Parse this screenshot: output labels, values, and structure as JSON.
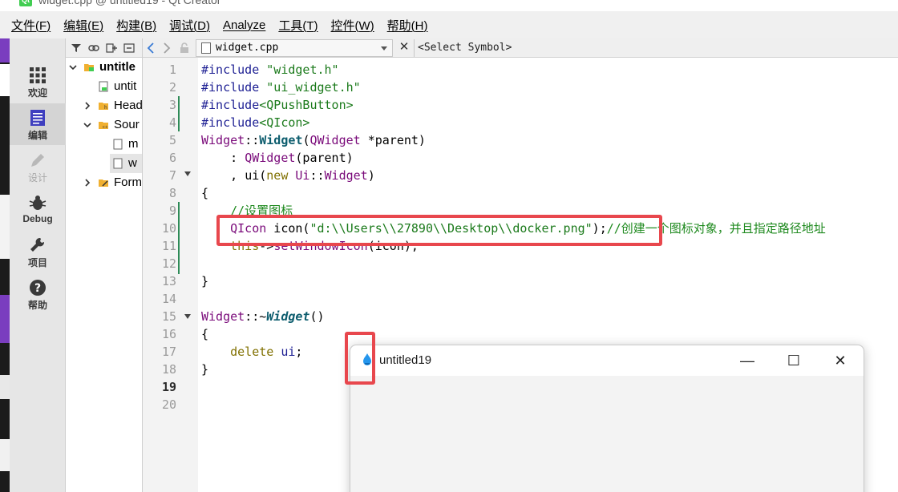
{
  "window": {
    "title": "widget.cpp @ untitled19 - Qt Creator"
  },
  "menu": [
    {
      "label": "文件(F)",
      "underline": true
    },
    {
      "label": "编辑(E)",
      "underline": true
    },
    {
      "label": "构建(B)",
      "underline": true
    },
    {
      "label": "调试(D)",
      "underline": true
    },
    {
      "label": "Analyze",
      "underline": true
    },
    {
      "label": "工具(T)",
      "underline": true
    },
    {
      "label": "控件(W)",
      "underline": true
    },
    {
      "label": "帮助(H)",
      "underline": true
    }
  ],
  "modes": [
    {
      "label": "欢迎",
      "icon": "grid-icon",
      "active": false
    },
    {
      "label": "编辑",
      "icon": "edit-doc-icon",
      "active": true
    },
    {
      "label": "设计",
      "icon": "pencil-icon",
      "active": false
    },
    {
      "label": "Debug",
      "icon": "bug-icon",
      "active": false
    },
    {
      "label": "项目",
      "icon": "wrench-icon",
      "active": false
    },
    {
      "label": "帮助",
      "icon": "help-icon",
      "active": false
    }
  ],
  "tree": {
    "items": [
      {
        "label": "untitle",
        "bold": true
      },
      {
        "label": "untit"
      },
      {
        "label": "Head"
      },
      {
        "label": "Sour"
      },
      {
        "label": "m"
      },
      {
        "label": "w",
        "selected": true
      },
      {
        "label": "Form"
      }
    ]
  },
  "editor": {
    "file_name": "widget.cpp",
    "symbol_placeholder": "<Select Symbol>",
    "current_line": 19,
    "line_numbers": [
      "1",
      "2",
      "3",
      "4",
      "5",
      "6",
      "7",
      "8",
      "9",
      "10",
      "11",
      "12",
      "13",
      "14",
      "15",
      "16",
      "17",
      "18",
      "19",
      "20"
    ],
    "code": {
      "l1_a": "#include ",
      "l1_b": "\"widget.h\"",
      "l2_a": "#include ",
      "l2_b": "\"ui_widget.h\"",
      "l3_a": "#include",
      "l3_b": "<QPushButton>",
      "l4_a": "#include",
      "l4_b": "<QIcon>",
      "l5_a": "Widget",
      "l5_b": "::",
      "l5_c": "Widget",
      "l5_d": "(",
      "l5_e": "QWidget",
      "l5_f": " *parent)",
      "l6_a": "    : ",
      "l6_b": "QWidget",
      "l6_c": "(parent)",
      "l7_a": "    , ",
      "l7_b": "ui",
      "l7_c": "(",
      "l7_d": "new",
      "l7_e": " ",
      "l7_f": "Ui",
      "l7_g": "::",
      "l7_h": "Widget",
      "l7_i": ")",
      "l8_a": "{",
      "l9_a": "    //设置图标",
      "l10_a": "    ",
      "l10_b": "QIcon",
      "l10_c": " icon(",
      "l10_d": "\"d:\\\\Users\\\\27890\\\\Desktop\\\\docker.png\"",
      "l10_e": ");",
      "l10_f": "//创建一个图标对象，并且指定路径地址",
      "l11_a": "    ",
      "l11_b": "this",
      "l11_c": "->",
      "l11_d": "setWindowIcon",
      "l11_e": "(icon);",
      "l13_a": "}",
      "l15_a": "Widget",
      "l15_b": "::~",
      "l15_c": "Widget",
      "l15_d": "()",
      "l16_a": "{",
      "l17_a": "    ",
      "l17_b": "delete",
      "l17_c": " ",
      "l17_d": "ui",
      "l17_e": ";",
      "l18_a": "}"
    }
  },
  "app_window": {
    "title": "untitled19",
    "minimize": "—",
    "maximize": "☐",
    "close": "✕"
  },
  "colors": {
    "highlight_box": "#e8474d",
    "string": "#1b7a1b",
    "class": "#7a0a7a",
    "function": "#0d5d6e"
  }
}
